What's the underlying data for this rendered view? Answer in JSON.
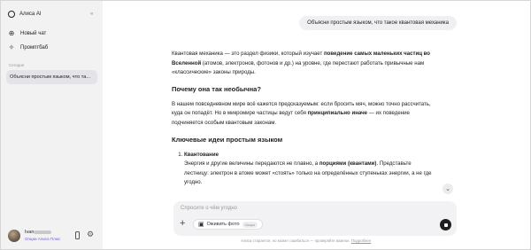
{
  "sidebar": {
    "brand": "Алиса AI",
    "items": [
      {
        "label": "Новый чат",
        "icon": "new-chat-icon"
      },
      {
        "label": "Промптбаб",
        "icon": "sparkle-icon"
      }
    ],
    "section": "Сегодня",
    "chats": [
      {
        "label": "Объясни простым языком, что та..."
      }
    ],
    "user": {
      "name": "Ivan",
      "subscription": "Опции Алиса Плюс"
    }
  },
  "chat": {
    "user_message": "Объясни простым языком, что такое квантовая механика",
    "p1": {
      "a": "Квантовая механика — это раздел физики, который изучает ",
      "b": "поведение самых маленьких частиц во Вселенной",
      "c": " (атомов, электронов, фотонов и др.) на уровне, где перестают работать привычные нам «классические» законы природы."
    },
    "h1": "Почему она так необычна?",
    "p2": {
      "a": "В нашем повседневном мире всё кажется предсказуемым: если бросить мяч, можно точно рассчитать, куда он попадёт. Но в микромире частицы ведут себя ",
      "b": "принципиально иначе",
      "c": " — их поведение подчиняется особым квантовым законам."
    },
    "h2": "Ключевые идеи простым языком",
    "li1": {
      "title": "Квантование",
      "a": "Энергия и другие величины передаются не плавно, а ",
      "b": "порциями (квантами)",
      "c": ". Представьте лестницу: электрон в атоме может «стоять» только на определённых ступеньках энергии, а не где угодно."
    }
  },
  "composer": {
    "placeholder": "Спросите о чём угодно",
    "chip_label": "Оживить фото",
    "chip_badge": "Скоро"
  },
  "disclaimer": {
    "text": "Алиса старается, но может ошибаться — проверяйте важное. ",
    "link": "Подробнее"
  }
}
